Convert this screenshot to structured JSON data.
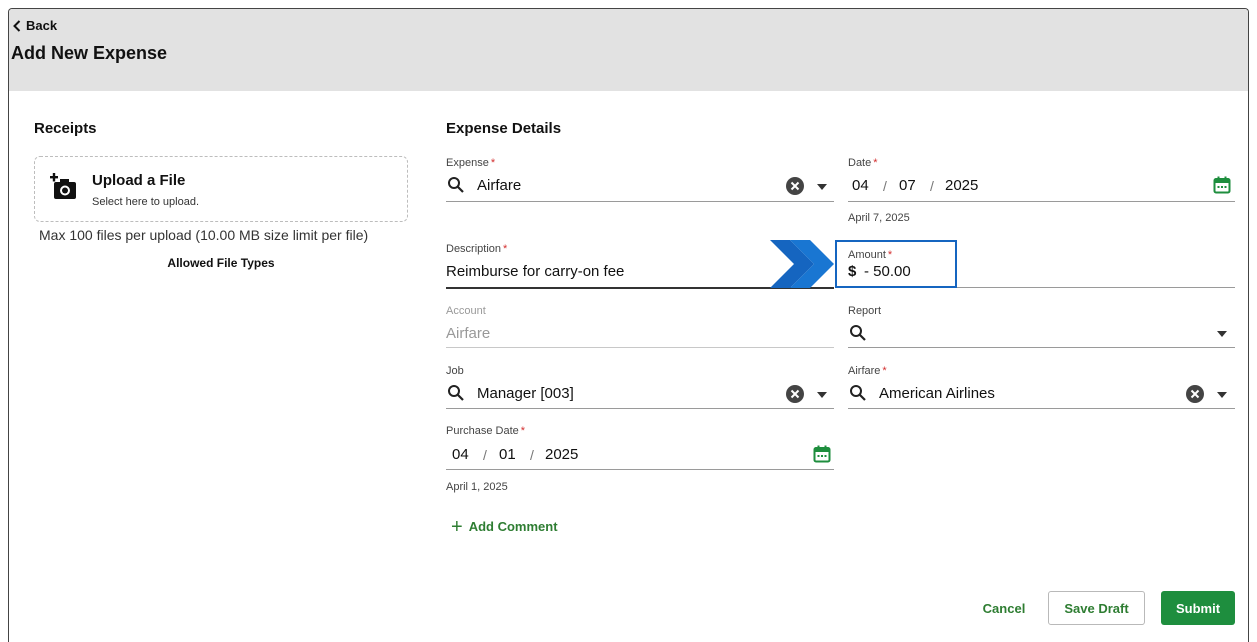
{
  "header": {
    "back_label": "Back",
    "title": "Add New Expense"
  },
  "receipts": {
    "title": "Receipts",
    "upload_title": "Upload a File",
    "upload_subtitle": "Select here to upload.",
    "limit_text": "Max 100 files per upload (10.00 MB size limit per file)",
    "allowed_types_label": "Allowed File Types"
  },
  "details": {
    "title": "Expense Details",
    "expense": {
      "label": "Expense",
      "value": "Airfare"
    },
    "date": {
      "label": "Date",
      "month": "04",
      "day": "07",
      "year": "2025",
      "separator": "/",
      "hint": "April 7, 2025"
    },
    "description": {
      "label": "Description",
      "value": "Reimburse for carry-on fee"
    },
    "amount": {
      "label": "Amount",
      "currency": "$",
      "value": "- 50.00"
    },
    "account": {
      "label": "Account",
      "value": "Airfare"
    },
    "report": {
      "label": "Report",
      "value": ""
    },
    "job": {
      "label": "Job",
      "value": "Manager [003]"
    },
    "airfare": {
      "label": "Airfare",
      "value": "American Airlines"
    },
    "purchase_date": {
      "label": "Purchase Date",
      "month": "04",
      "day": "01",
      "year": "2025",
      "separator": "/",
      "hint": "April 1, 2025"
    },
    "required_marker": "*"
  },
  "add_comment_label": "Add Comment",
  "add_comment_symbol": "+",
  "actions": {
    "cancel": "Cancel",
    "save_draft": "Save Draft",
    "submit": "Submit"
  },
  "colors": {
    "accent_green": "#1e8e3e",
    "highlight_blue": "#1565c0",
    "required_red": "#d32f2f",
    "header_gray": "#e2e2e2"
  }
}
